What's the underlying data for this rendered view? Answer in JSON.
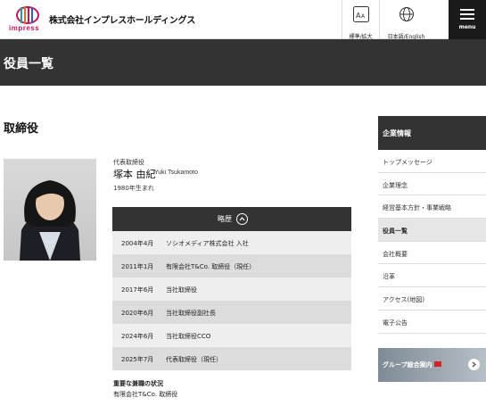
{
  "header": {
    "logo_word": "impress",
    "company_name": "株式会社インプレスホールディングス",
    "font_size_button": "標準/拡大",
    "language_button": "日本語/English",
    "menu_label": "menu"
  },
  "page": {
    "title": "役員一覧",
    "section_title": "取締役"
  },
  "profile": {
    "role": "代表取締役",
    "name": "塚本 由紀",
    "name_romaji": "Yuki Tsukamoto",
    "birth": "1980年生まれ"
  },
  "history": {
    "heading": "略歴",
    "rows": [
      {
        "date": "2004年4月",
        "event": "ソシオメディア株式会社 入社"
      },
      {
        "date": "2011年1月",
        "event": "有限会社T&Co. 取締役（現任）"
      },
      {
        "date": "2017年6月",
        "event": "当社取締役"
      },
      {
        "date": "2020年6月",
        "event": "当社取締役副社長"
      },
      {
        "date": "2024年6月",
        "event": "当社取締役CCO"
      },
      {
        "date": "2025年7月",
        "event": "代表取締役（現任）"
      }
    ]
  },
  "concurrent": {
    "heading": "重要な兼職の状況",
    "value": "有限会社T&Co. 取締役"
  },
  "sidebar": {
    "heading": "企業情報",
    "items": [
      {
        "label": "トップメッセージ"
      },
      {
        "label": "企業理念"
      },
      {
        "label": "経営基本方針・事業戦略"
      },
      {
        "label": "役員一覧"
      },
      {
        "label": "会社概要"
      },
      {
        "label": "沿革"
      },
      {
        "label": "アクセス(地図)"
      },
      {
        "label": "電子公告"
      }
    ],
    "active_index": 3,
    "banner_text": "グループ総合案内"
  },
  "colors": {
    "dark_bar": "#333333",
    "brand_magenta": "#c0145c",
    "row_light": "#eeeeee",
    "row_dark": "#dcdcdc"
  },
  "icons": [
    "impress-logo-icon",
    "font-size-icon",
    "globe-icon",
    "hamburger-icon",
    "chevron-up-icon",
    "arrow-right-icon"
  ]
}
